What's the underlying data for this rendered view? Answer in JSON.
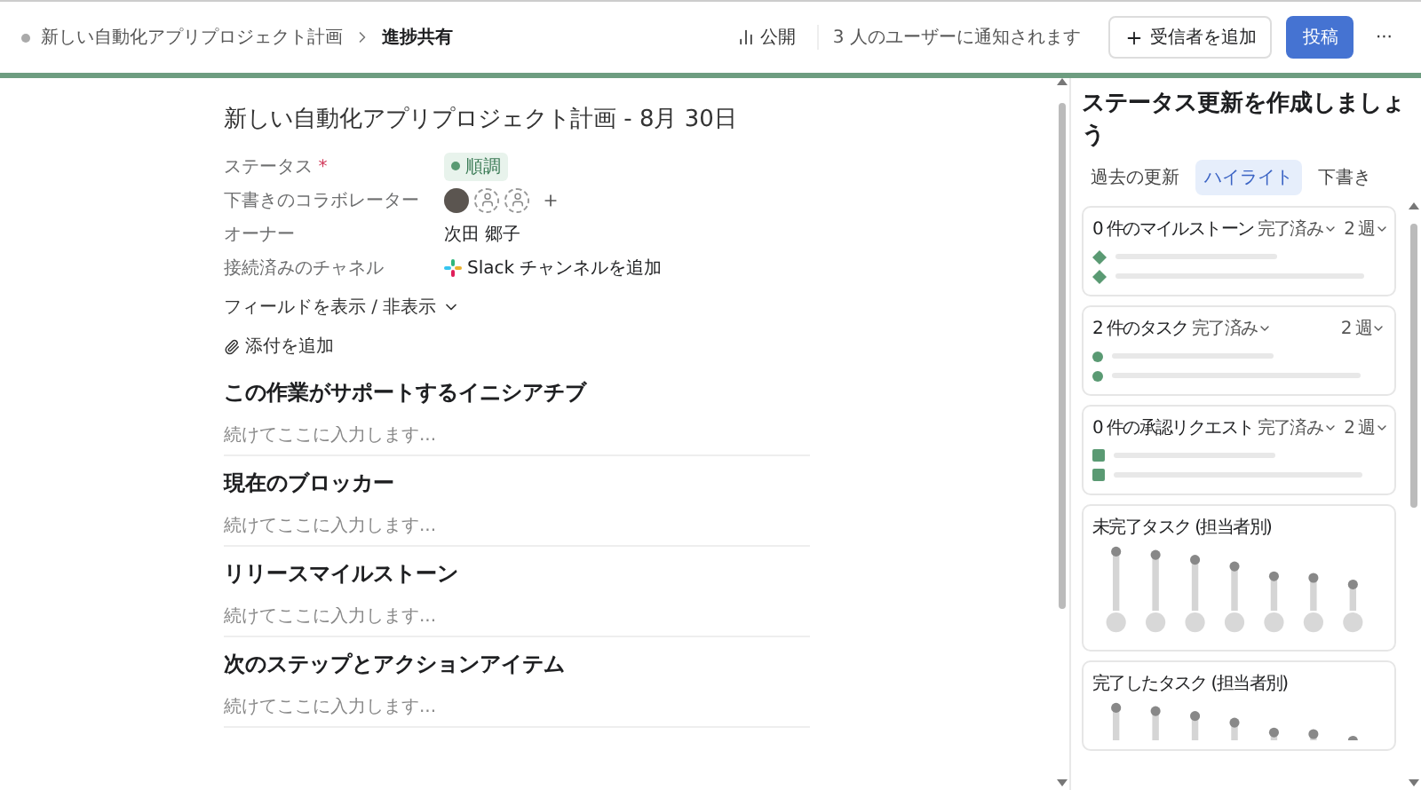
{
  "header": {
    "breadcrumb": [
      "新しい自動化アプリプロジェクト計画",
      "進捗共有"
    ],
    "visibility": "公開",
    "notice": "3 人のユーザーに通知されます",
    "add_recipient": "受信者を追加",
    "post": "投稿",
    "more": "···"
  },
  "document": {
    "title": "新しい自動化アプリプロジェクト計画 - 8月 30日",
    "fields": [
      {
        "kind": "status",
        "label": "ステータス",
        "required_mark": "*",
        "value": "順調"
      },
      {
        "kind": "people",
        "label": "下書きのコラボレーター",
        "avatars": [
          {
            "kind": "photo"
          },
          {
            "kind": "empty"
          },
          {
            "kind": "empty"
          }
        ]
      },
      {
        "kind": "text",
        "label": "オーナー",
        "value": "次田 郷子"
      },
      {
        "kind": "link",
        "label": "接続済みのチャネル",
        "value": "Slack チャンネルを追加"
      }
    ],
    "toggle_fields": "フィールドを表示 / 非表示",
    "attach": "添付を追加",
    "sections": [
      {
        "heading": "この作業がサポートするイニシアチブ",
        "placeholder": "続けてここに入力します..."
      },
      {
        "heading": "現在のブロッカー",
        "placeholder": "続けてここに入力します..."
      },
      {
        "heading": "リリースマイルストーン",
        "placeholder": "続けてここに入力します..."
      },
      {
        "heading": "次のステップとアクションアイテム",
        "placeholder": "続けてここに入力します..."
      }
    ]
  },
  "panel": {
    "title": "ステータス更新を作成しましょう",
    "tabs": [
      {
        "label": "過去の更新",
        "selected": false
      },
      {
        "label": "ハイライト",
        "selected": true
      },
      {
        "label": "下書き",
        "selected": false
      }
    ],
    "cards": [
      {
        "kind": "milestone",
        "title": "0 件のマイルストーン",
        "filter": "完了済み",
        "period": "2 週"
      },
      {
        "kind": "task",
        "title": "2 件のタスク",
        "filter": "完了済み",
        "period": "2 週"
      },
      {
        "kind": "approval",
        "title": "0 件の承認リクエスト",
        "filter": "完了済み",
        "period": "2 週"
      }
    ],
    "charts": [
      {
        "title": "未完了タスク (担当者別)"
      },
      {
        "title": "完了したタスク (担当者別)"
      }
    ]
  }
}
